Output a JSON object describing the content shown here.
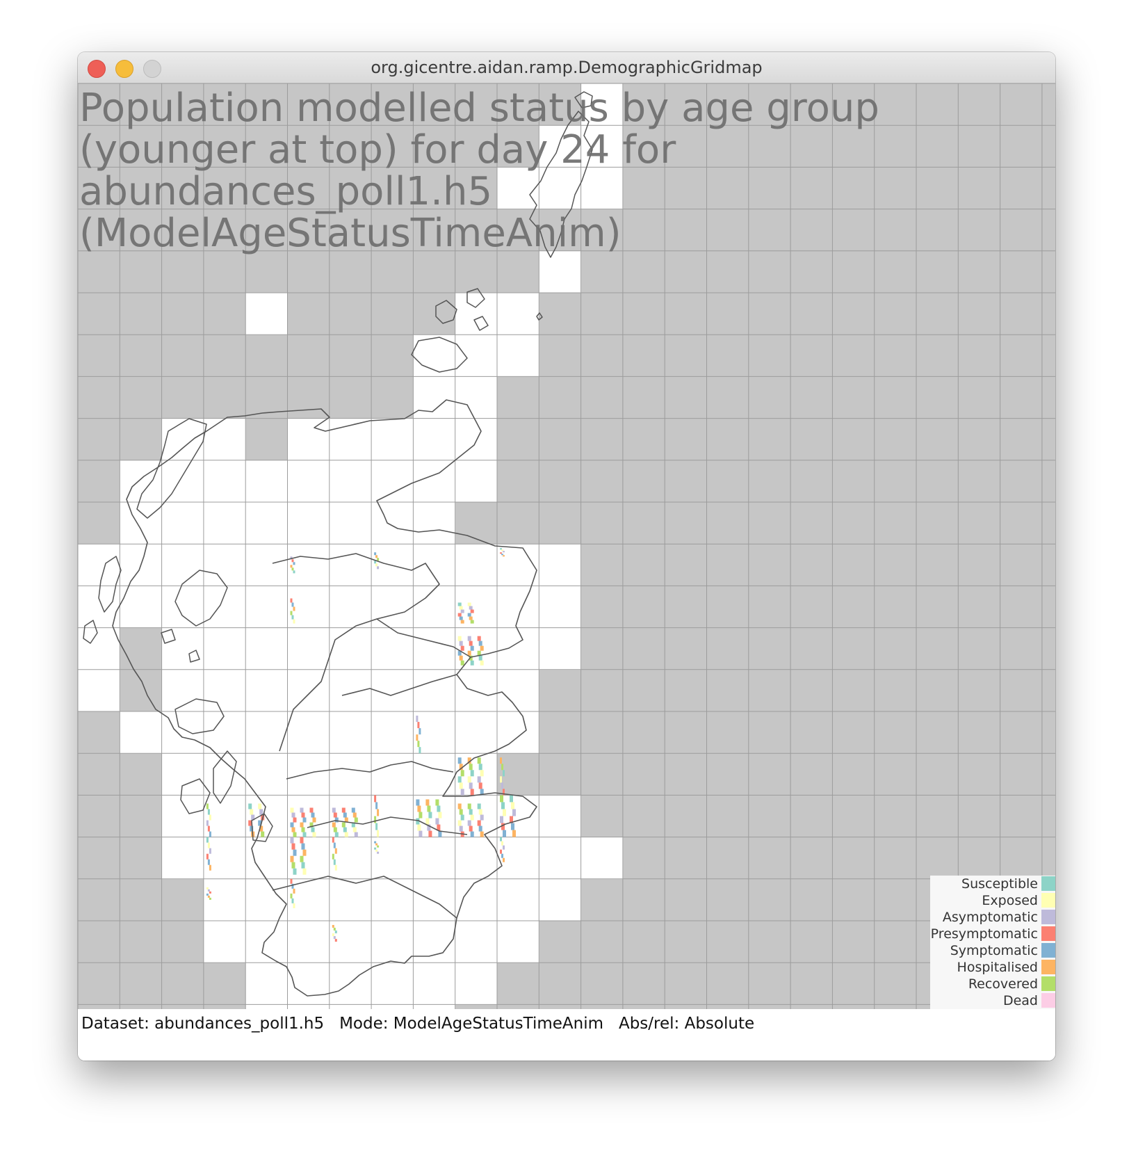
{
  "window": {
    "title": "org.gicentre.aidan.ramp.DemographicGridmap"
  },
  "map": {
    "heading": "Population modelled status by age group (younger at top) for day 24 for abundances_poll1.h5 (ModelAgeStatusTimeAnim)",
    "colors": {
      "background": "#c6c6c6",
      "cell": "#ffffff",
      "gridline": "#9c9c9c",
      "coastline": "#555555"
    }
  },
  "legend": {
    "items": [
      {
        "label": "Susceptible",
        "color": "#8dd3c7"
      },
      {
        "label": "Exposed",
        "color": "#ffffb3"
      },
      {
        "label": "Asymptomatic",
        "color": "#bebada"
      },
      {
        "label": "Presymptomatic",
        "color": "#fb8072"
      },
      {
        "label": "Symptomatic",
        "color": "#80b1d3"
      },
      {
        "label": "Hospitalised",
        "color": "#fdb462"
      },
      {
        "label": "Recovered",
        "color": "#b3de69"
      },
      {
        "label": "Dead",
        "color": "#fccde5"
      }
    ]
  },
  "status_bar": {
    "dataset_label": "Dataset: abundances_poll1.h5",
    "mode_label": "Mode: ModelAgeStatusTimeAnim",
    "absrel_label": "Abs/rel: Absolute"
  }
}
